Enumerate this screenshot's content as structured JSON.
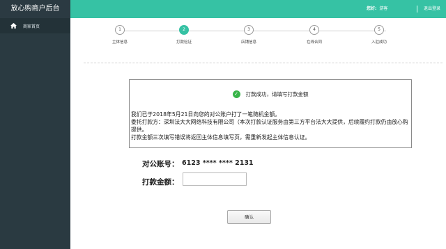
{
  "brand": "放心购商户后台",
  "header": {
    "greeting": "您好:",
    "username": "游客",
    "logout": "退出登录"
  },
  "sidebar": {
    "items": [
      {
        "label": "商家首页",
        "icon": "home-icon"
      }
    ]
  },
  "stepper": {
    "steps": [
      {
        "number": "1",
        "label": "主体信息"
      },
      {
        "number": "2",
        "label": "打款验证"
      },
      {
        "number": "3",
        "label": "店铺信息"
      },
      {
        "number": "4",
        "label": "在线合同"
      },
      {
        "number": "5",
        "label": "入驻成功"
      }
    ],
    "active_index": 1
  },
  "message": {
    "title": "打款成功，请填写打款金额",
    "line1": "我们已于2018年5月21日向您的对公账户打了一笔随机金额。",
    "line2": "委托打款方：深圳法大大网络科技有限公司（本次打款认证服务由第三方平台法大大提供，后续履约打款仍由放心购提供。",
    "line3": "打款金额三次填写错误将返回主体信息填写页，需重新发起主体信息认证。"
  },
  "account": {
    "label": "对公账号：",
    "value": "6123 **** **** 2131"
  },
  "amount": {
    "label": "打款金额：",
    "value": "",
    "placeholder": ""
  },
  "confirm_label": "确认",
  "colors": {
    "accent": "#36c2a4",
    "sidebar": "#2a3a41",
    "success": "#39b54a"
  }
}
